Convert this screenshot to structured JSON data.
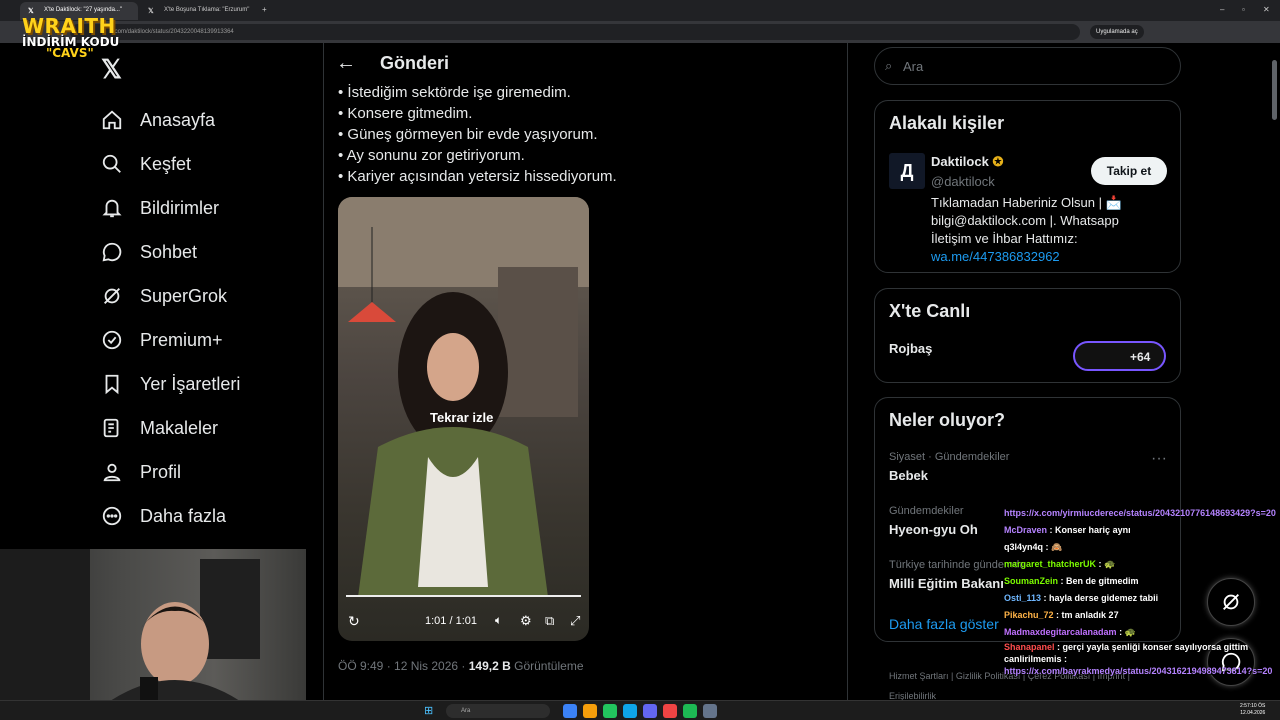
{
  "browser": {
    "tabs": [
      {
        "label": "X'te Daktilock: \"27 yaşında...\"",
        "active": true
      },
      {
        "label": "X'te Boşuna Tıklama: \"Erzurum\"",
        "active": false
      }
    ],
    "url": "x.com/daktilock/status/2043220048139913364",
    "app_button": "Uygulamada aç"
  },
  "overlay": {
    "brand_top": "WRAITH",
    "brand_mid": "İNDİRİM KODU",
    "brand_code": "\"CAVS\""
  },
  "nav": {
    "items": [
      {
        "label": "Anasayfa",
        "icon": "home-icon"
      },
      {
        "label": "Keşfet",
        "icon": "search-icon"
      },
      {
        "label": "Bildirimler",
        "icon": "bell-icon"
      },
      {
        "label": "Sohbet",
        "icon": "chat-icon"
      },
      {
        "label": "SuperGrok",
        "icon": "grok-icon"
      },
      {
        "label": "Premium+",
        "icon": "verified-icon"
      },
      {
        "label": "Yer İşaretleri",
        "icon": "bookmark-icon"
      },
      {
        "label": "Makaleler",
        "icon": "article-icon"
      },
      {
        "label": "Profil",
        "icon": "person-icon"
      },
      {
        "label": "Daha fazla",
        "icon": "more-icon"
      }
    ]
  },
  "post": {
    "header": "Gönderi",
    "bullets": [
      "• İstediğim sektörde işe giremedim.",
      "• Konsere gitmedim.",
      "• Güneş görmeyen bir evde yaşıyorum.",
      "• Ay sonunu zor getiriyorum.",
      "• Kariyer açısından yetersiz hissediyorum."
    ],
    "video": {
      "replay_label": "Tekrar izle",
      "time": "1:01 / 1:01",
      "progress": 1.0
    },
    "time": "ÖÖ 9:49 · 12 Nis 2026 ·",
    "views": "149,2 B",
    "views_label": "Görüntüleme"
  },
  "sidebar": {
    "search_placeholder": "Ara",
    "related": {
      "title": "Alakalı kişiler",
      "name": "Daktilock",
      "handle": "@daktilock",
      "follow": "Takip et",
      "bio": "Tıklamadan Haberiniz Olsun | 📩 bilgi@daktilock.com |. Whatsapp İletişim ve İhbar Hattımız:",
      "link": "wa.me/447386832962"
    },
    "live": {
      "title": "X'te Canlı",
      "name": "Rojbaş",
      "count": "+64"
    },
    "trends": {
      "title": "Neler oluyor?",
      "items": [
        {
          "context": "Siyaset · Gündemdekiler",
          "name": "Bebek"
        },
        {
          "context": "Gündemdekiler",
          "name": "Hyeon-gyu Oh"
        },
        {
          "context": "Türkiye tarihinde gündemde",
          "name": "Milli Eğitim Bakanı"
        }
      ],
      "more": "Daha fazla göster"
    },
    "footer": "Hizmet Şartları | Gizlilik Politikası | Çerez Politikası | İmprint | Erişilebilirlik"
  },
  "chat": [
    {
      "user": "",
      "text": "https://x.com/yirmiucderece/status/2043210776148693429?s=20",
      "color": "#b583ff"
    },
    {
      "user": "McDraven",
      "text": ": Konser hariç aynı",
      "color": "#b583ff"
    },
    {
      "user": "q3l4yn4q",
      "text": ": 🙈",
      "color": "#ffffff"
    },
    {
      "user": "margaret_thatcherUK",
      "text": ": 🐢",
      "color": "#7cfc00"
    },
    {
      "user": "SoumanZein",
      "text": ": Ben de gitmedim",
      "color": "#7cfc00"
    },
    {
      "user": "Osti_113",
      "text": ": hayla derse gidemez tabii",
      "color": "#6fb7ff"
    },
    {
      "user": "Pikachu_72",
      "text": ": tm anladık 27",
      "color": "#ffb347"
    },
    {
      "user": "Madmaxdegitarcalanadam",
      "text": ": 🐢",
      "color": "#c071ff"
    },
    {
      "user": "Shanapanel",
      "text": ": gerçi yayla şenliği konser sayılıyorsa gittim canlirilmemis :",
      "color": "#ff4d4d"
    },
    {
      "user": "",
      "text": "https://x.com/bayrakmedya/status/2043162194989473814?s=20",
      "color": "#b583ff"
    }
  ],
  "taskbar": {
    "search": "Ara",
    "time": "2:57:10 ÖS",
    "date": "12.04.2026"
  },
  "colors": {
    "accent": "#1d9bf0",
    "bg": "#000000",
    "border": "#2f3336"
  }
}
